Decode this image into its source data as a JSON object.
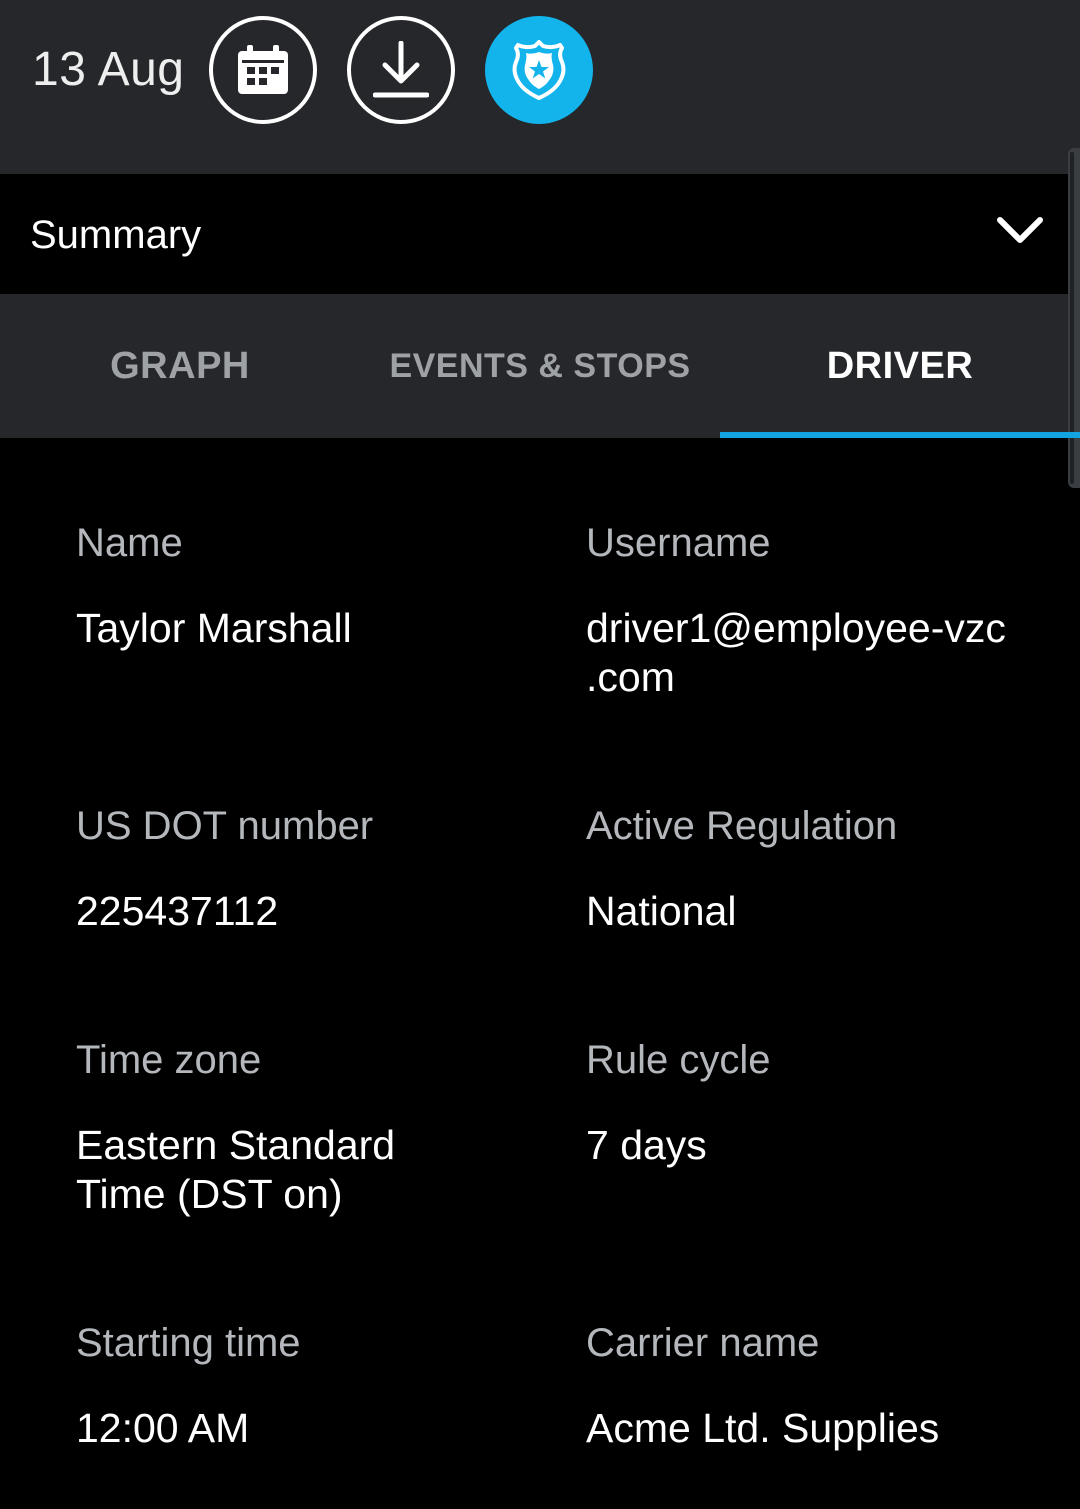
{
  "header": {
    "date": "13 Aug",
    "buttons": [
      {
        "icon": "calendar-icon"
      },
      {
        "icon": "download-icon"
      },
      {
        "icon": "shield-badge-icon",
        "color": "#13b4ec"
      }
    ]
  },
  "summary": {
    "label": "Summary",
    "icon": "chevron-down-icon"
  },
  "tabs": [
    {
      "label": "GRAPH",
      "selected": false
    },
    {
      "label": "EVENTS & STOPS",
      "selected": false
    },
    {
      "label": "DRIVER",
      "selected": true
    }
  ],
  "accent_color": "#13a3e0",
  "driver": {
    "name": {
      "label": "Name",
      "value": "Taylor Marshall"
    },
    "username": {
      "label": "Username",
      "value": "driver1@employee-vzc\n.com"
    },
    "dot": {
      "label": "US DOT number",
      "value": "225437112"
    },
    "regulation": {
      "label": "Active Regulation",
      "value": "National"
    },
    "timezone": {
      "label": "Time zone",
      "value": "Eastern Standard\nTime (DST on)"
    },
    "rule_cycle": {
      "label": "Rule cycle",
      "value": "7 days"
    },
    "starting_time": {
      "label": "Starting time",
      "value": "12:00 AM"
    },
    "carrier": {
      "label": "Carrier name",
      "value": "Acme Ltd. Supplies"
    }
  }
}
